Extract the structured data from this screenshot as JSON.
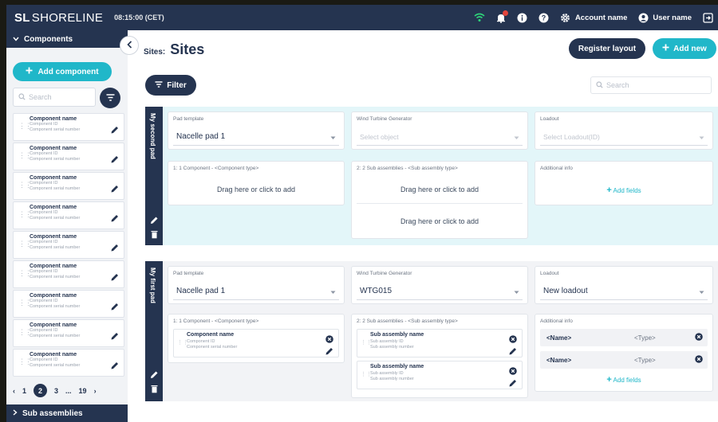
{
  "topbar": {
    "logo_mark": "SL",
    "logo_name": "SHORELINE",
    "time": "08:15:00 (CET)",
    "account": "Account name",
    "user": "User name"
  },
  "sidebar": {
    "header": "Components",
    "add_label": "Add component",
    "search_placeholder": "Search",
    "items": [
      {
        "name": "Component name",
        "id": "Component ID",
        "serial": "Component serial number"
      },
      {
        "name": "Component name",
        "id": "Component ID",
        "serial": "Component serial number"
      },
      {
        "name": "Component name",
        "id": "Component ID",
        "serial": "Component serial number"
      },
      {
        "name": "Component name",
        "id": "Component ID",
        "serial": "Component serial number"
      },
      {
        "name": "Component name",
        "id": "Component ID",
        "serial": "Component serial number"
      },
      {
        "name": "Component name",
        "id": "Component ID",
        "serial": "Component serial number"
      },
      {
        "name": "Component name",
        "id": "Component ID",
        "serial": "Component serial number"
      },
      {
        "name": "Component name",
        "id": "Component ID",
        "serial": "Component serial number"
      },
      {
        "name": "Component name",
        "id": "Component ID",
        "serial": "Component serial number"
      }
    ],
    "pager": {
      "prev": "‹",
      "p1": "1",
      "current": "2",
      "p3": "3",
      "ellipsis": "...",
      "last": "19",
      "next": "›"
    },
    "footer": "Sub assemblies"
  },
  "main": {
    "breadcrumb_parent": "Sites:",
    "title": "Sites",
    "register_label": "Register layout",
    "add_new_label": "Add new",
    "filter_label": "Filter",
    "search_placeholder": "Search"
  },
  "pads": [
    {
      "label": "My second pad",
      "pad_template_label": "Pad template",
      "pad_template_value": "Nacelle pad 1",
      "wtg_label": "Wind Turbine Generator",
      "wtg_value": "Select object",
      "loadout_label": "Loadout",
      "loadout_value": "Select Loadout(ID)",
      "slot1_title": "1: 1 Component - <Component type>",
      "slot1_drop": "Drag here or click to add",
      "slot2_title": "2: 2 Sub assemblies - <Sub assembly type>",
      "slot2_drop1": "Drag here or click to add",
      "slot2_drop2": "Drag here or click to add",
      "info_title": "Additional info",
      "add_fields": "Add fields"
    },
    {
      "label": "My first pad",
      "pad_template_label": "Pad template",
      "pad_template_value": "Nacelle pad 1",
      "wtg_label": "Wind Turbine Generator",
      "wtg_value": "WTG015",
      "loadout_label": "Loadout",
      "loadout_value": "New loadout",
      "slot1_title": "1: 1 Component - <Component type>",
      "component": {
        "name": "Component name",
        "id": "Component ID",
        "serial": "Component serial number"
      },
      "slot2_title": "2: 2 Sub assemblies - <Sub assembly type>",
      "subs": [
        {
          "name": "Sub assembly name",
          "id": "Sub assembly ID",
          "serial": "Sub assembly number"
        },
        {
          "name": "Sub assembly name",
          "id": "Sub assembly ID",
          "serial": "Sub assembly number"
        }
      ],
      "info_title": "Additional info",
      "fields": [
        {
          "name": "<Name>",
          "type": "<Type>"
        },
        {
          "name": "<Name>",
          "type": "<Type>"
        }
      ],
      "add_fields": "Add fields"
    }
  ],
  "colors": {
    "navy": "#253450",
    "teal": "#20b7c9",
    "pad_bg": "#e3f6f9",
    "danger": "#e2453c"
  },
  "icons": [
    "wifi-icon",
    "bell-icon",
    "info-icon",
    "help-icon",
    "gear-icon",
    "user-icon",
    "logout-icon",
    "chevron-left-icon",
    "filter-icon",
    "search-icon",
    "pencil-icon",
    "trash-icon",
    "close-circle-icon",
    "drag-handle-icon",
    "plus-icon",
    "chevron-down-icon"
  ]
}
